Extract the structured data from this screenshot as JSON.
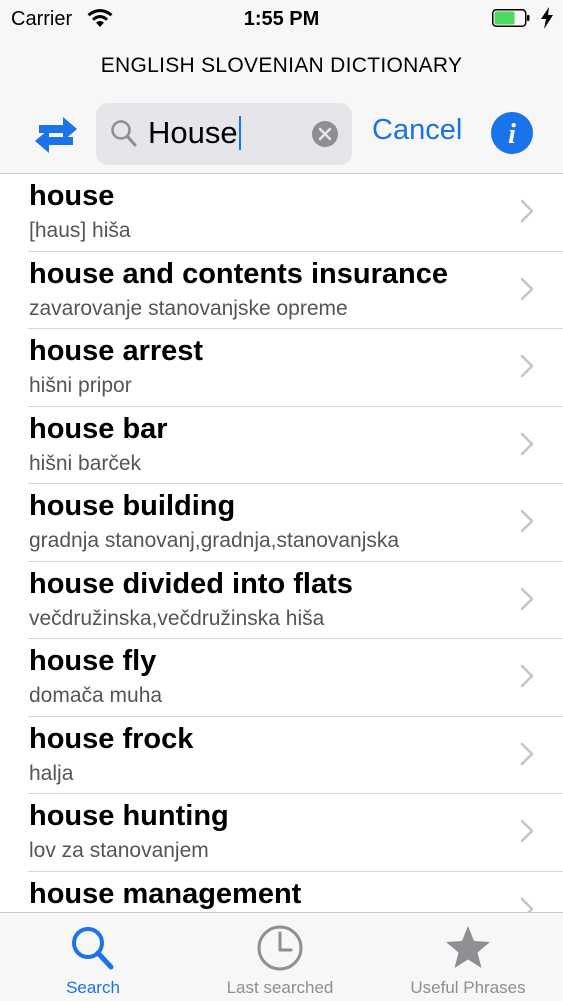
{
  "status": {
    "carrier": "Carrier",
    "time": "1:55 PM"
  },
  "header": {
    "title": "ENGLISH SLOVENIAN DICTIONARY",
    "search_value": "House",
    "cancel_label": "Cancel",
    "icons": [
      "swap-icon",
      "search-icon",
      "clear-icon",
      "info-icon"
    ]
  },
  "results": [
    {
      "en": "house",
      "sl": "[haus] hiša"
    },
    {
      "en": "house and contents insurance",
      "sl": "zavarovanje stanovanjske opreme"
    },
    {
      "en": "house arrest",
      "sl": "hišni pripor"
    },
    {
      "en": "house bar",
      "sl": "hišni barček"
    },
    {
      "en": "house building",
      "sl": "gradnja stanovanj,gradnja,stanovanjska"
    },
    {
      "en": "house divided into flats",
      "sl": "večdružinska,večdružinska hiša"
    },
    {
      "en": "house fly",
      "sl": "domača muha"
    },
    {
      "en": "house frock",
      "sl": "halja"
    },
    {
      "en": "house hunting",
      "sl": "lov za stanovanjem"
    },
    {
      "en": "house management",
      "sl": ""
    }
  ],
  "tabs": [
    {
      "label": "Search",
      "active": true
    },
    {
      "label": "Last searched",
      "active": false
    },
    {
      "label": "Useful Phrases",
      "active": false
    }
  ],
  "colors": {
    "accent": "#1a73e8",
    "inactive": "#8e8e93",
    "battery": "#4cd964"
  }
}
